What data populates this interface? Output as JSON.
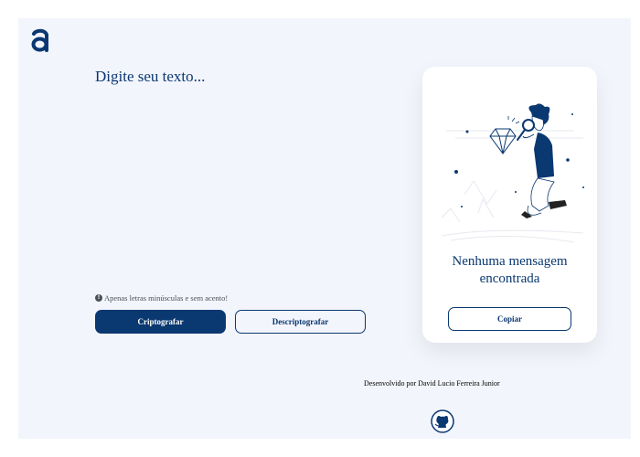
{
  "input": {
    "placeholder": "Digite seu texto..."
  },
  "hint": {
    "text": "Apenas letras minúsculas e sem acento!",
    "icon": "info-icon"
  },
  "actions": {
    "encrypt_label": "Criptografar",
    "decrypt_label": "Descriptografar"
  },
  "output": {
    "empty_message": "Nenhuma mensagem encontrada",
    "copy_label": "Copiar"
  },
  "footer": {
    "credit": "Desenvolvido por David Lucio Ferreira Junior",
    "github_icon": "github-icon"
  },
  "colors": {
    "background": "#f3f5fc",
    "primary": "#0a3871",
    "card": "#ffffff"
  }
}
